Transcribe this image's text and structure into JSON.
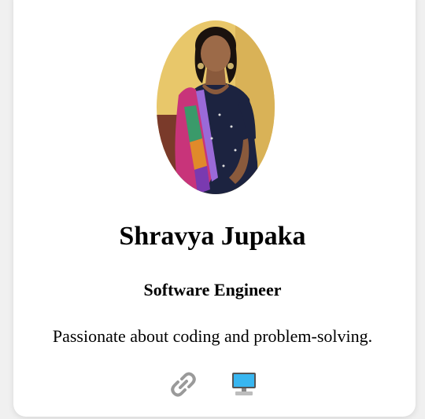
{
  "profile": {
    "name": "Shravya Jupaka",
    "title": "Software Engineer",
    "bio": "Passionate about coding and problem-solving."
  },
  "links": [
    {
      "icon": "link-icon"
    },
    {
      "icon": "computer-icon"
    }
  ],
  "colors": {
    "card_bg": "#ffffff",
    "page_bg": "#f0f0f0",
    "link_icon": "#9a9a9a",
    "computer_screen": "#38b6f0"
  }
}
